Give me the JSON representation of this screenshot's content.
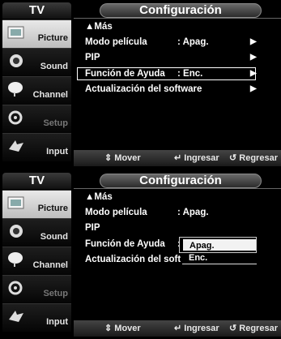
{
  "panels": [
    {
      "tv_label": "TV",
      "title": "Configuración",
      "sidebar": [
        {
          "label": "Picture",
          "icon": "picture-icon",
          "state": "active"
        },
        {
          "label": "Sound",
          "icon": "sound-icon",
          "state": "normal"
        },
        {
          "label": "Channel",
          "icon": "channel-icon",
          "state": "normal"
        },
        {
          "label": "Setup",
          "icon": "setup-icon",
          "state": "dim"
        },
        {
          "label": "Input",
          "icon": "input-icon",
          "state": "normal"
        }
      ],
      "menu": [
        {
          "label": "▲Más",
          "value": "",
          "arrow": false
        },
        {
          "label": "Modo película",
          "value": ": Apag.",
          "arrow": true
        },
        {
          "label": "PIP",
          "value": "",
          "arrow": true
        },
        {
          "label": "Función de Ayuda",
          "value": ": Enc.",
          "arrow": true,
          "highlighted": true
        },
        {
          "label": "Actualización del software",
          "value": "",
          "arrow": true
        }
      ],
      "footer": [
        {
          "icon": "⇕",
          "label": "Mover"
        },
        {
          "icon": "↵",
          "label": "Ingresar"
        },
        {
          "icon": "↺",
          "label": "Regresar"
        }
      ]
    },
    {
      "tv_label": "TV",
      "title": "Configuración",
      "sidebar": [
        {
          "label": "Picture",
          "icon": "picture-icon",
          "state": "active"
        },
        {
          "label": "Sound",
          "icon": "sound-icon",
          "state": "normal"
        },
        {
          "label": "Channel",
          "icon": "channel-icon",
          "state": "normal"
        },
        {
          "label": "Setup",
          "icon": "setup-icon",
          "state": "dim"
        },
        {
          "label": "Input",
          "icon": "input-icon",
          "state": "normal"
        }
      ],
      "menu": [
        {
          "label": "▲Más",
          "value": ""
        },
        {
          "label": "Modo película",
          "value": ": Apag."
        },
        {
          "label": "PIP",
          "value": ""
        },
        {
          "label": "Función de Ayuda",
          "value": ":"
        },
        {
          "label": "Actualización del soft",
          "value": ""
        }
      ],
      "popup": {
        "options": [
          "Apag.",
          "Enc."
        ],
        "selected_index": 0
      },
      "footer": [
        {
          "icon": "⇕",
          "label": "Mover"
        },
        {
          "icon": "↵",
          "label": "Ingresar"
        },
        {
          "icon": "↺",
          "label": "Regresar"
        }
      ]
    }
  ],
  "colors": {
    "background": "#000000",
    "text": "#ffffff",
    "active_sidebar": "#d8d8d8"
  }
}
